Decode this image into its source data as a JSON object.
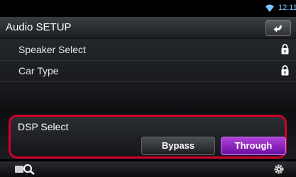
{
  "status": {
    "time": "12:11",
    "wifi_icon": "wifi-icon"
  },
  "header": {
    "title": "Audio SETUP",
    "back_icon": "back-arrow-icon"
  },
  "settings": [
    {
      "label": "Speaker Select",
      "icon": "lock-icon"
    },
    {
      "label": "Car Type",
      "icon": "lock-icon"
    }
  ],
  "dsp": {
    "label": "DSP Select",
    "options": [
      "Bypass",
      "Through"
    ],
    "selected": "Through"
  },
  "bottom": {
    "left_icon": "search-icon",
    "right_icon": "gear-icon"
  },
  "colors": {
    "highlight": "#d0002a",
    "selected": "#8a1cc4",
    "clock": "#7ec3ff"
  }
}
